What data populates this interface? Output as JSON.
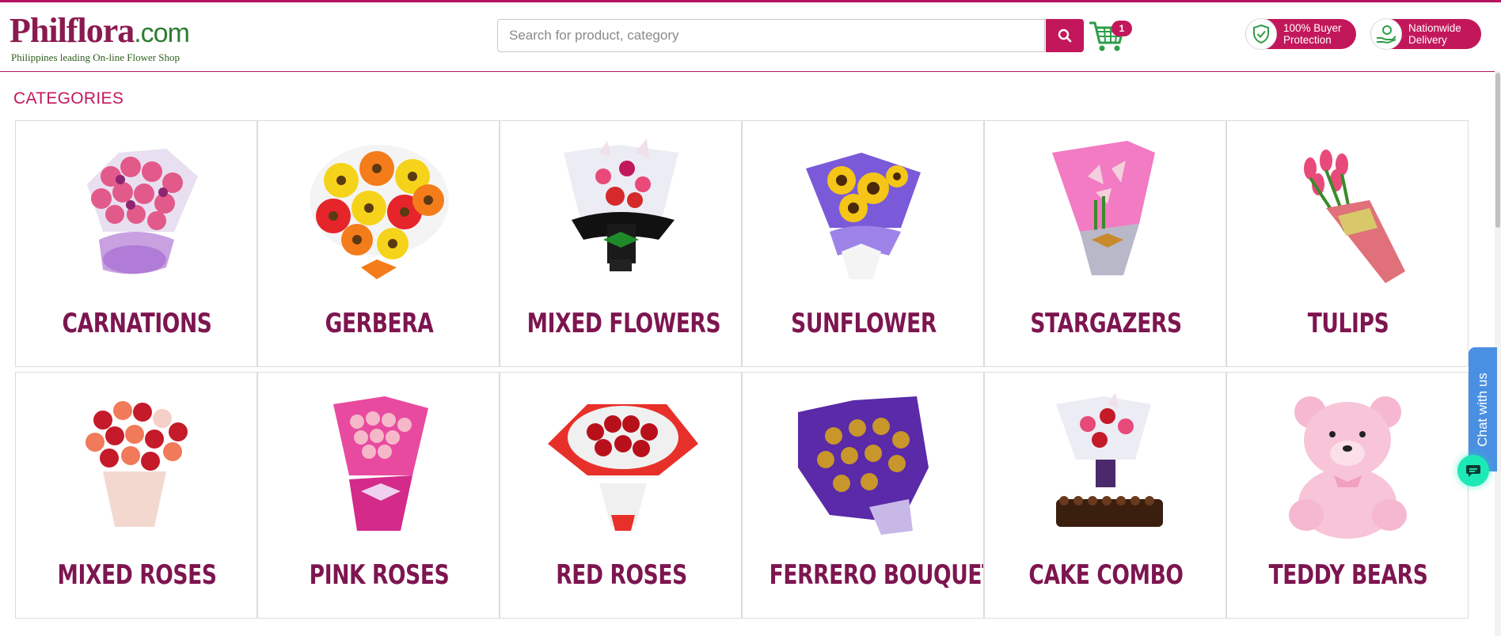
{
  "header": {
    "logo_main": "hilflora",
    "logo_initial": "P",
    "logo_domain": ".com",
    "logo_tagline": "Philippines leading On-line Flower Shop",
    "search_placeholder": "Search for product, category",
    "search_value": "",
    "cart_count": "1",
    "buyer_protection": "100% Buyer Protection",
    "nationwide_delivery": "Nationwide Delivery"
  },
  "categories_title": "CATEGORIES",
  "categories": [
    {
      "label": "CARNATIONS",
      "icon": "carnations-bouquet-image"
    },
    {
      "label": "GERBERA",
      "icon": "gerbera-bouquet-image"
    },
    {
      "label": "MIXED FLOWERS",
      "icon": "mixed-flowers-bouquet-image"
    },
    {
      "label": "SUNFLOWER",
      "icon": "sunflower-bouquet-image"
    },
    {
      "label": "STARGAZERS",
      "icon": "stargazers-bouquet-image"
    },
    {
      "label": "TULIPS",
      "icon": "tulips-bouquet-image"
    },
    {
      "label": "MIXED ROSES",
      "icon": "mixed-roses-bouquet-image"
    },
    {
      "label": "PINK ROSES",
      "icon": "pink-roses-bouquet-image"
    },
    {
      "label": "RED ROSES",
      "icon": "red-roses-bouquet-image"
    },
    {
      "label": "FERRERO BOUQUET",
      "icon": "ferrero-bouquet-image"
    },
    {
      "label": "CAKE COMBO",
      "icon": "cake-combo-image"
    },
    {
      "label": "TEDDY BEARS",
      "icon": "teddy-bear-image"
    }
  ],
  "chat": {
    "tab_label": "Chat with us"
  },
  "colors": {
    "brand": "#c2185b",
    "label": "#7d1550",
    "chat_tab": "#4a90e2",
    "chat_bubble": "#1de9b6"
  }
}
